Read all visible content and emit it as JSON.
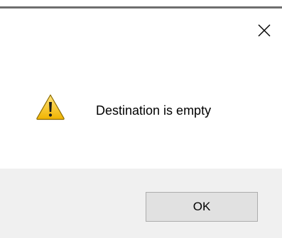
{
  "dialog": {
    "message": "Destination is empty",
    "icon": "warning-icon",
    "close_icon": "close-icon",
    "ok_label": "OK"
  },
  "colors": {
    "warning_fill": "#f2c31d",
    "warning_border": "#8a6a00",
    "footer_bg": "#f0f0f0",
    "button_bg": "#e1e1e1",
    "button_border": "#adadad"
  }
}
